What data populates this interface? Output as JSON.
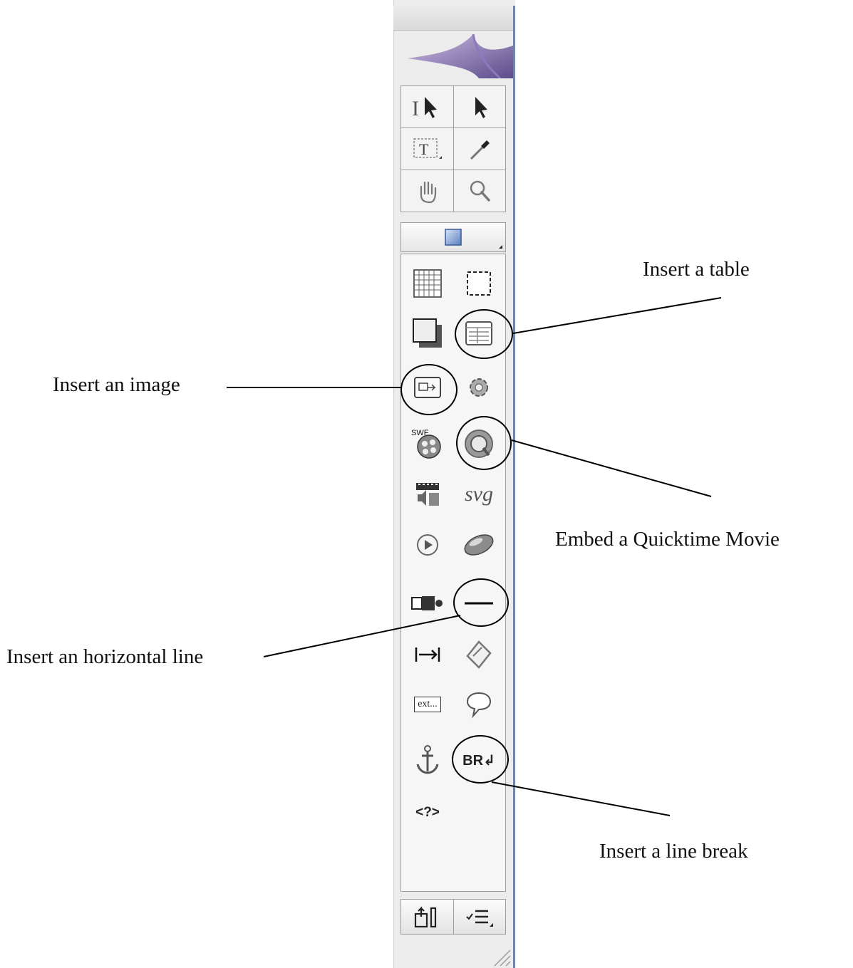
{
  "callouts": {
    "table": "Insert a table",
    "image": "Insert an image",
    "quicktime": "Embed a Quicktime Movie",
    "hline": "Insert an horizontal  line",
    "linebreak": "Insert a line break"
  },
  "objects": {
    "svg_label": "svg",
    "swf_label": "SWF",
    "text_label": "ext...",
    "br_label": "BR",
    "pi_label": "<?>"
  },
  "icons": {
    "tools": [
      "text-select-arrow-icon",
      "select-arrow-icon",
      "text-box-icon",
      "eyedropper-icon",
      "hand-icon",
      "magnifier-icon"
    ],
    "mode": "blue-square-icon",
    "bottom": [
      "export-icon",
      "checklist-menu-icon"
    ]
  },
  "colors": {
    "panel_bg": "#ececec",
    "panel_edge": "#6f86a8",
    "logo_star": "#6d5a9e"
  }
}
